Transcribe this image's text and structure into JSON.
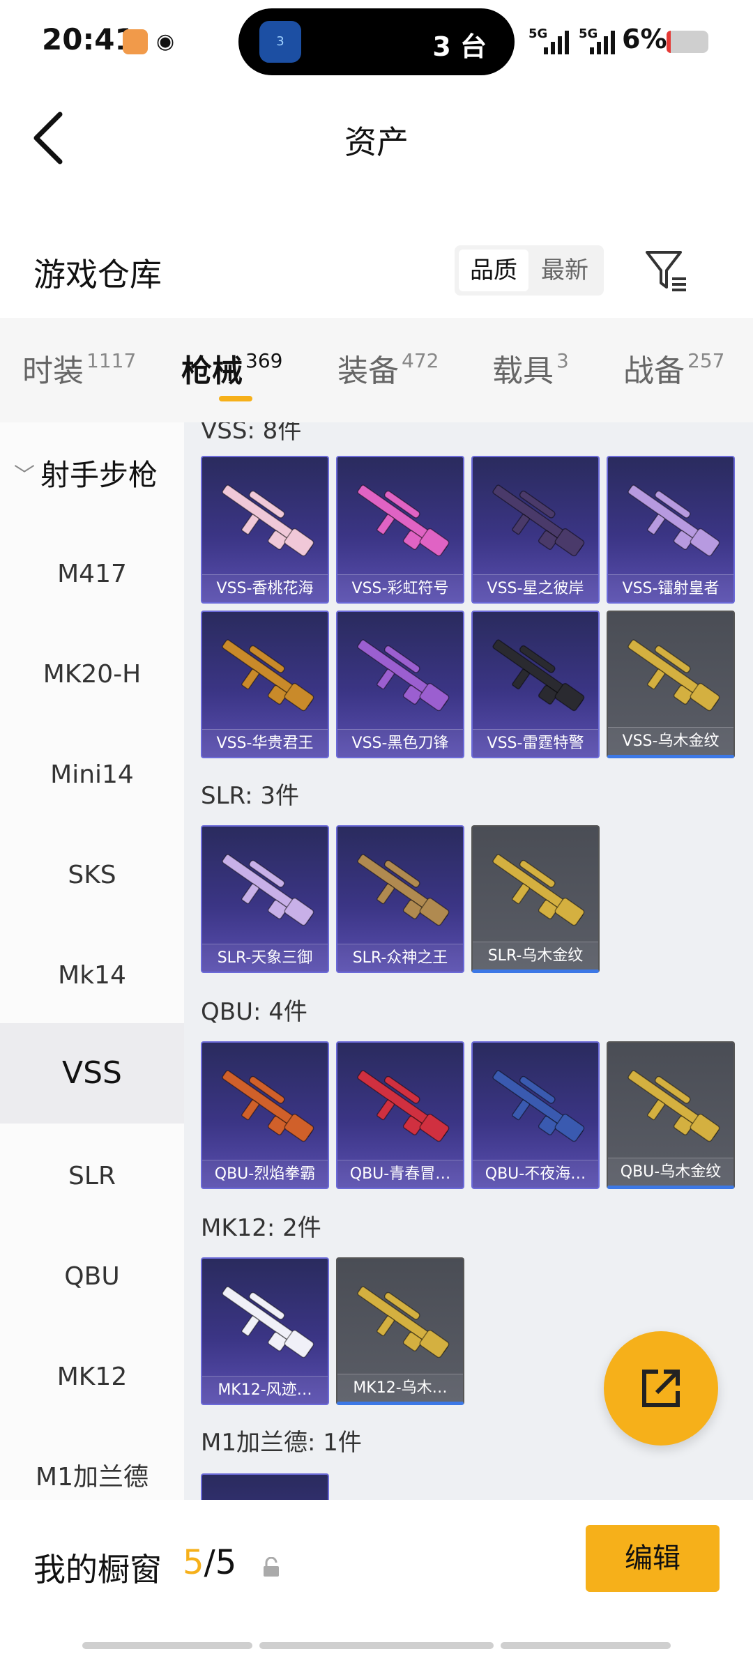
{
  "status_bar": {
    "time": "20:41",
    "island_badge": "3",
    "island_text": "3 台",
    "net1": "5G",
    "net2": "5G",
    "battery_text": "6%"
  },
  "header": {
    "title": "资产",
    "section_title": "游戏仓库",
    "sort_quality": "品质",
    "sort_latest": "最新"
  },
  "tabs": [
    {
      "label": "时装",
      "count": "1117"
    },
    {
      "label": "枪械",
      "count": "369"
    },
    {
      "label": "装备",
      "count": "472"
    },
    {
      "label": "载具",
      "count": "3"
    },
    {
      "label": "战备",
      "count": "257"
    }
  ],
  "sidebar": {
    "group": "射手步枪",
    "items": [
      "M417",
      "MK20-H",
      "Mini14",
      "SKS",
      "Mk14",
      "VSS",
      "SLR",
      "QBU",
      "MK12",
      "M1加兰德"
    ]
  },
  "content": {
    "groups": [
      {
        "label": "VSS: 8件",
        "items": [
          {
            "name": "VSS-香桃花海",
            "style": "purple",
            "color": "#f0c8d8"
          },
          {
            "name": "VSS-彩虹符号",
            "style": "purple",
            "color": "#e063c4"
          },
          {
            "name": "VSS-星之彼岸",
            "style": "purple",
            "color": "#4a3a6a"
          },
          {
            "name": "VSS-镭射皇者",
            "style": "purple",
            "color": "#b79ae0"
          },
          {
            "name": "VSS-华贵君王",
            "style": "purple",
            "color": "#c98a2a"
          },
          {
            "name": "VSS-黑色刀锋",
            "style": "purple",
            "color": "#9b5fd0"
          },
          {
            "name": "VSS-雷霆特警",
            "style": "purple",
            "color": "#2a2a30"
          },
          {
            "name": "VSS-乌木金纹",
            "style": "gray",
            "color": "#d4b040"
          }
        ]
      },
      {
        "label": "SLR: 3件",
        "items": [
          {
            "name": "SLR-天象三御",
            "style": "purple",
            "color": "#c8b0e8"
          },
          {
            "name": "SLR-众神之王",
            "style": "purple",
            "color": "#b08a50"
          },
          {
            "name": "SLR-乌木金纹",
            "style": "gray",
            "color": "#d4b040"
          }
        ]
      },
      {
        "label": "QBU: 4件",
        "items": [
          {
            "name": "QBU-烈焰拳霸",
            "style": "purple",
            "color": "#d0602a"
          },
          {
            "name": "QBU-青春冒…",
            "style": "purple",
            "color": "#d03040"
          },
          {
            "name": "QBU-不夜海…",
            "style": "purple",
            "color": "#3a5ab0"
          },
          {
            "name": "QBU-乌木金纹",
            "style": "gray",
            "color": "#d4b040"
          }
        ]
      },
      {
        "label": "MK12: 2件",
        "items": [
          {
            "name": "MK12-风迹…",
            "style": "purple",
            "color": "#f0f0f8"
          },
          {
            "name": "MK12-乌木…",
            "style": "gray",
            "color": "#d4b040"
          }
        ]
      },
      {
        "label": "M1加兰德: 1件",
        "items": [
          {
            "name": "",
            "style": "purple",
            "color": "#8a6a3a"
          }
        ]
      }
    ]
  },
  "bottom": {
    "showcase_label": "我的橱窗",
    "showcase_used": "5",
    "showcase_sep": "/",
    "showcase_total": "5",
    "edit_label": "编辑"
  },
  "colors": {
    "accent": "#f6b01a",
    "card_purple": "#3b3585",
    "card_gray": "#555a63"
  }
}
